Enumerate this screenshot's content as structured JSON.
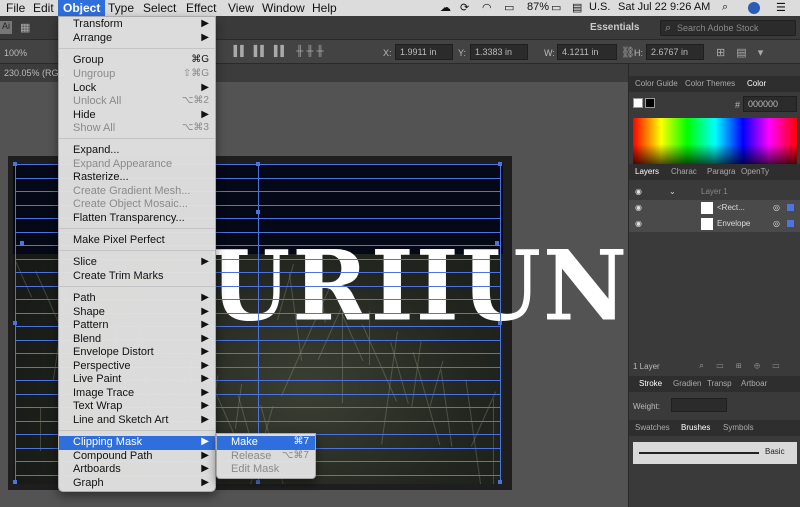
{
  "menubar": {
    "items": [
      "File",
      "Edit",
      "Object",
      "Type",
      "Select",
      "Effect",
      "View",
      "Window",
      "Help"
    ],
    "battery": "87%",
    "input_source": "U.S.",
    "clock": "Sat Jul 22  9:26 AM"
  },
  "appbar": {
    "workspace": "Essentials",
    "search_placeholder": "Search Adobe Stock"
  },
  "controlbar": {
    "zoom": "100%",
    "x_label": "X:",
    "x_value": "1.9911 in",
    "y_label": "Y:",
    "y_value": "1.3383 in",
    "w_label": "W:",
    "w_value": "4.1211 in",
    "h_label": "H:",
    "h_value": "2.6767 in"
  },
  "document": {
    "tab_title": "230.05% (RGB"
  },
  "canvas": {
    "artwork_text": "URIIUN"
  },
  "color_panel": {
    "tabs": [
      "Color Guide",
      "Color Themes",
      "Color"
    ],
    "hex_prefix": "#",
    "hex_value": "000000"
  },
  "layers_panel": {
    "tabs": [
      "Layers",
      "Charac",
      "Paragra",
      "OpenTy"
    ],
    "rows": [
      {
        "label": "Layer 1"
      },
      {
        "label": "<Rect..."
      },
      {
        "label": "Envelope"
      }
    ],
    "count": "1 Layer"
  },
  "stroke_panel": {
    "tabs": [
      "Stroke",
      "Gradien",
      "Transp",
      "Artboar"
    ],
    "weight_label": "Weight:"
  },
  "brushes_panel": {
    "tabs": [
      "Swatches",
      "Brushes",
      "Symbols"
    ],
    "brush_label": "Basic"
  },
  "object_menu": {
    "items": [
      {
        "label": "Transform",
        "shortcut": "",
        "submenu": true,
        "disabled": false
      },
      {
        "label": "Arrange",
        "shortcut": "",
        "submenu": true,
        "disabled": false
      },
      {
        "label": "Group",
        "shortcut": "⌘G",
        "submenu": false,
        "disabled": false
      },
      {
        "label": "Ungroup",
        "shortcut": "⇧⌘G",
        "submenu": false,
        "disabled": true
      },
      {
        "label": "Lock",
        "shortcut": "",
        "submenu": true,
        "disabled": false
      },
      {
        "label": "Unlock All",
        "shortcut": "⌥⌘2",
        "submenu": false,
        "disabled": true
      },
      {
        "label": "Hide",
        "shortcut": "",
        "submenu": true,
        "disabled": false
      },
      {
        "label": "Show All",
        "shortcut": "⌥⌘3",
        "submenu": false,
        "disabled": true
      },
      {
        "label": "Expand...",
        "shortcut": "",
        "submenu": false,
        "disabled": false
      },
      {
        "label": "Expand Appearance",
        "shortcut": "",
        "submenu": false,
        "disabled": true
      },
      {
        "label": "Rasterize...",
        "shortcut": "",
        "submenu": false,
        "disabled": false
      },
      {
        "label": "Create Gradient Mesh...",
        "shortcut": "",
        "submenu": false,
        "disabled": true
      },
      {
        "label": "Create Object Mosaic...",
        "shortcut": "",
        "submenu": false,
        "disabled": true
      },
      {
        "label": "Flatten Transparency...",
        "shortcut": "",
        "submenu": false,
        "disabled": false
      },
      {
        "label": "Make Pixel Perfect",
        "shortcut": "",
        "submenu": false,
        "disabled": false
      },
      {
        "label": "Slice",
        "shortcut": "",
        "submenu": true,
        "disabled": false
      },
      {
        "label": "Create Trim Marks",
        "shortcut": "",
        "submenu": false,
        "disabled": false
      },
      {
        "label": "Path",
        "shortcut": "",
        "submenu": true,
        "disabled": false
      },
      {
        "label": "Shape",
        "shortcut": "",
        "submenu": true,
        "disabled": false
      },
      {
        "label": "Pattern",
        "shortcut": "",
        "submenu": true,
        "disabled": false
      },
      {
        "label": "Blend",
        "shortcut": "",
        "submenu": true,
        "disabled": false
      },
      {
        "label": "Envelope Distort",
        "shortcut": "",
        "submenu": true,
        "disabled": false
      },
      {
        "label": "Perspective",
        "shortcut": "",
        "submenu": true,
        "disabled": false
      },
      {
        "label": "Live Paint",
        "shortcut": "",
        "submenu": true,
        "disabled": false
      },
      {
        "label": "Image Trace",
        "shortcut": "",
        "submenu": true,
        "disabled": false
      },
      {
        "label": "Text Wrap",
        "shortcut": "",
        "submenu": true,
        "disabled": false
      },
      {
        "label": "Line and Sketch Art",
        "shortcut": "",
        "submenu": true,
        "disabled": false
      },
      {
        "label": "Clipping Mask",
        "shortcut": "",
        "submenu": true,
        "disabled": false
      },
      {
        "label": "Compound Path",
        "shortcut": "",
        "submenu": true,
        "disabled": false
      },
      {
        "label": "Artboards",
        "shortcut": "",
        "submenu": true,
        "disabled": false
      },
      {
        "label": "Graph",
        "shortcut": "",
        "submenu": true,
        "disabled": false
      }
    ]
  },
  "clipping_submenu": {
    "items": [
      {
        "label": "Make",
        "shortcut": "⌘7",
        "disabled": false
      },
      {
        "label": "Release",
        "shortcut": "⌥⌘7",
        "disabled": true
      },
      {
        "label": "Edit Mask",
        "shortcut": "",
        "disabled": true
      }
    ]
  },
  "colors": {
    "selection": "#2f6fdd",
    "path": "#4c73e0"
  }
}
